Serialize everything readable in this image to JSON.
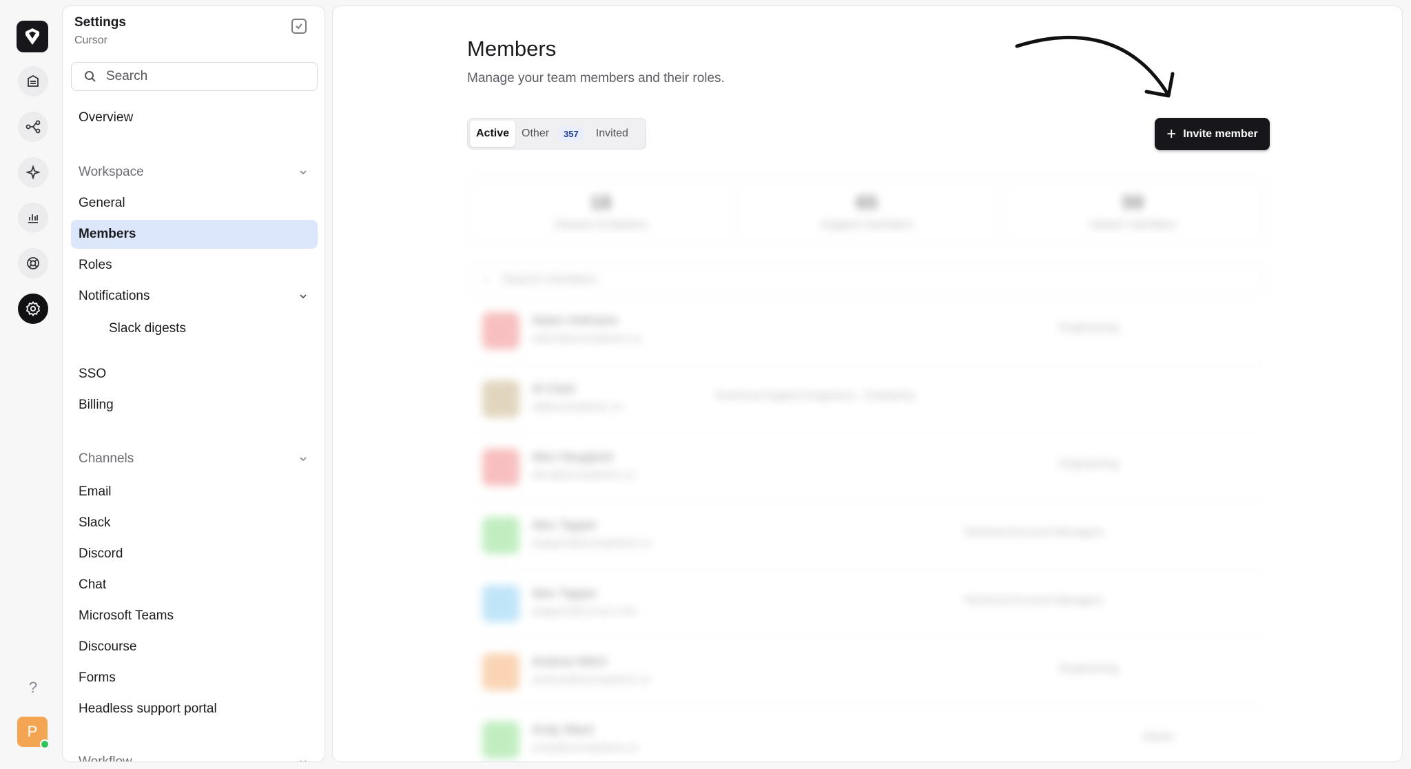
{
  "rail": {
    "icons": [
      "logo-icon",
      "inbox-icon",
      "workflow-icon",
      "sparkle-icon",
      "analytics-icon",
      "support-icon",
      "settings-icon"
    ],
    "help_label": "?",
    "avatar_initial": "P",
    "avatar_color": "#f4a553",
    "online_color": "#2fc45b"
  },
  "sidebar": {
    "title": "Settings",
    "subtitle": "Cursor",
    "search_placeholder": "Search",
    "overview": "Overview",
    "workspace": {
      "label": "Workspace",
      "items": [
        "General",
        "Members",
        "Roles",
        "Notifications"
      ],
      "notifications_sub": "Slack digests",
      "more": [
        "SSO",
        "Billing"
      ]
    },
    "channels": {
      "label": "Channels",
      "items": [
        "Email",
        "Slack",
        "Discord",
        "Chat",
        "Microsoft Teams",
        "Discourse",
        "Forms",
        "Headless support portal"
      ]
    },
    "workflow": {
      "label": "Workflow"
    },
    "selected_color": "#dde7fb"
  },
  "main": {
    "title": "Members",
    "description": "Manage your team members and their roles.",
    "tabs": [
      {
        "label": "Active"
      },
      {
        "label": "Other",
        "count": "357"
      },
      {
        "label": "Invited"
      }
    ],
    "invite_label": "Invite member",
    "stats": [
      {
        "num": "18",
        "label": "Owners & Admins"
      },
      {
        "num": "65",
        "label": "Support members"
      },
      {
        "num": "59",
        "label": "Viewer members"
      }
    ],
    "members_search_placeholder": "Search members",
    "members": [
      {
        "name": "Adam Hofmann",
        "email": "adam@acmeplants.co",
        "role": "Engineering",
        "color": "#f28b8b"
      },
      {
        "name": "Al Clark",
        "email": "al@acmeplants.co",
        "role": "Technical Support Engineers - Enterprise",
        "color": "#c9b48a"
      },
      {
        "name": "Alex Haugland",
        "email": "alex@acmeplants.co",
        "role": "Engineering",
        "color": "#f28b8b"
      },
      {
        "name": "Alex Tapper",
        "email": "atapper@acmeplants.co",
        "role": "Technical Account Managers",
        "color": "#8fe08f"
      },
      {
        "name": "Alex Tapper",
        "email": "atapper@curson.com",
        "role": "Technical Account Managers",
        "color": "#8fd0f4"
      },
      {
        "name": "Andrew Mitch",
        "email": "andrew@acmeplants.co",
        "role": "Engineering",
        "color": "#f6b27a"
      },
      {
        "name": "Andy Ward",
        "email": "andy@acmeplants.co",
        "role": "Admin",
        "color": "#8fe08f"
      }
    ]
  }
}
